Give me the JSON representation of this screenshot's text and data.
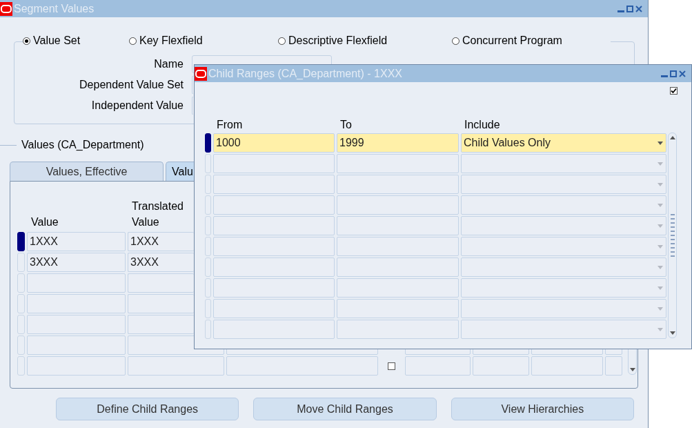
{
  "main_window": {
    "title": "Segment Values",
    "radios": [
      {
        "label": "Value Set",
        "selected": true
      },
      {
        "label": "Key Flexfield",
        "selected": false
      },
      {
        "label": "Descriptive Flexfield",
        "selected": false
      },
      {
        "label": "Concurrent Program",
        "selected": false
      }
    ],
    "fields": [
      {
        "label": "Name"
      },
      {
        "label": "Dependent Value Set"
      },
      {
        "label": "Independent Value"
      }
    ],
    "section_title": "Values (CA_Department)",
    "tabs": [
      {
        "label": "Values, Effective",
        "selected": false
      },
      {
        "label": "Valu",
        "selected": true
      }
    ],
    "table": {
      "columns": [
        "Value",
        "Translated Value"
      ],
      "rows": [
        {
          "current": true,
          "value": "1XXX",
          "translated_value": "1XXX"
        },
        {
          "current": false,
          "value": "3XXX",
          "translated_value": "3XXX"
        },
        {
          "current": false
        },
        {
          "current": false
        },
        {
          "current": false
        },
        {
          "current": false
        },
        {
          "current": false,
          "checked": false
        }
      ]
    },
    "buttons": [
      "Define Child Ranges",
      "Move Child Ranges",
      "View Hierarchies"
    ]
  },
  "child_window": {
    "title": "Child Ranges (CA_Department) - 1XXX",
    "checked": true,
    "columns": [
      "From",
      "To",
      "Include"
    ],
    "rows": [
      {
        "current": true,
        "from": "1000",
        "to": "1999",
        "include": "Child Values Only"
      },
      {
        "current": false
      },
      {
        "current": false
      },
      {
        "current": false
      },
      {
        "current": false
      },
      {
        "current": false
      },
      {
        "current": false
      },
      {
        "current": false
      },
      {
        "current": false
      },
      {
        "current": false
      }
    ]
  }
}
